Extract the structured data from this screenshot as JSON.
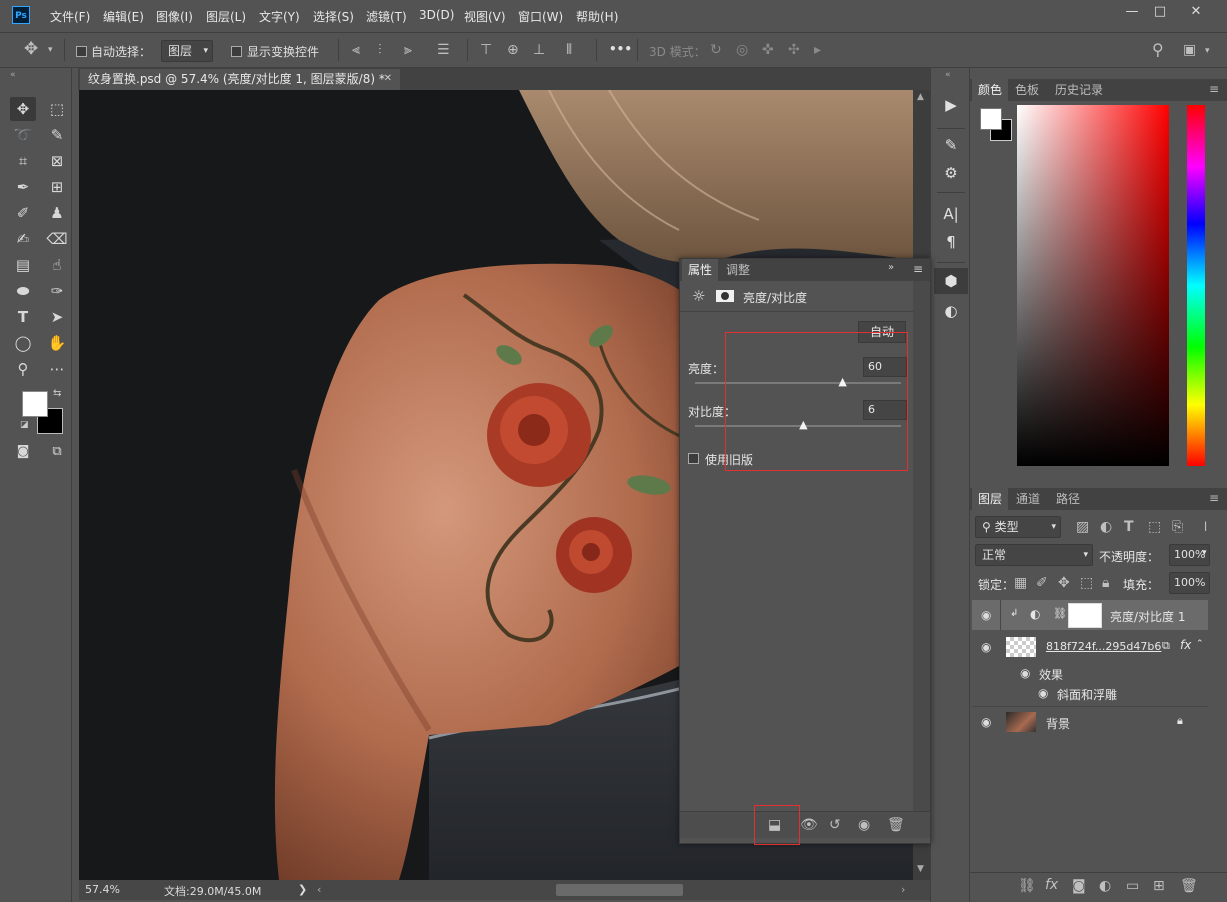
{
  "app": {
    "logo_text": "Ps"
  },
  "menu": [
    "文件(F)",
    "编辑(E)",
    "图像(I)",
    "图层(L)",
    "文字(Y)",
    "选择(S)",
    "滤镜(T)",
    "3D(D)",
    "视图(V)",
    "窗口(W)",
    "帮助(H)"
  ],
  "window_controls": {
    "minimize": "—",
    "maximize": "□",
    "close": "✕"
  },
  "options": {
    "auto_select_label": "自动选择：",
    "auto_select_target": "图层",
    "show_transform_label": "显示变换控件",
    "more": "•••",
    "mode3d_label": "3D 模式："
  },
  "document": {
    "tab_title": "纹身置换.psd @ 57.4% (亮度/对比度 1, 图层蒙版/8) *",
    "tab_close": "✕",
    "zoom": "57.4%",
    "doc_size": "文档:29.0M/45.0M",
    "status_arrow": "❯"
  },
  "colors": {
    "foreground": "#ffffff",
    "background": "#000000",
    "accent_red": "#e03030"
  },
  "properties": {
    "tabs": [
      "属性",
      "调整"
    ],
    "title": "亮度/对比度",
    "auto_button": "自动",
    "brightness_label": "亮度：",
    "brightness_value": "60",
    "brightness_level": 0.72,
    "contrast_label": "对比度：",
    "contrast_value": "6",
    "contrast_level": 0.53,
    "legacy_label": "使用旧版",
    "legacy_checked": false
  },
  "color_panel": {
    "tabs": [
      "颜色",
      "色板",
      "历史记录"
    ]
  },
  "layers_panel": {
    "tabs": [
      "图层",
      "通道",
      "路径"
    ],
    "filter_kind": "类型",
    "blend_mode": "正常",
    "opacity_label": "不透明度：",
    "opacity_value": "100%",
    "lock_label": "锁定：",
    "fill_label": "填充：",
    "fill_value": "100%",
    "layers": [
      {
        "name": "亮度/对比度 1",
        "type": "adjustment",
        "selected": true
      },
      {
        "name": "818f724f...295d47b6",
        "type": "smart",
        "fx": "fx"
      },
      {
        "name": "效果",
        "type": "effect-group"
      },
      {
        "name": "斜面和浮雕",
        "type": "effect"
      },
      {
        "name": "背景",
        "type": "background",
        "locked": true
      }
    ]
  },
  "icons": {
    "move": "move-icon",
    "eye": "eye-icon",
    "trash": "trash-icon"
  }
}
